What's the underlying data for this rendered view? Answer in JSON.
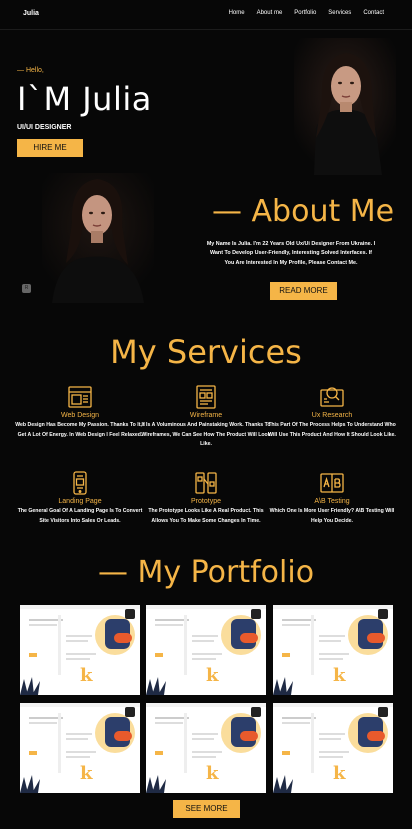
{
  "nav": {
    "logo": "Julia",
    "links": [
      "Home",
      "About me",
      "Portfolio",
      "Services",
      "Contact"
    ]
  },
  "hero": {
    "greeting": "— Hello,",
    "title": "I`M Julia",
    "role": "UI/UI DESIGNER",
    "hire_button": "HIRE ME"
  },
  "about": {
    "title": "— About Me",
    "text": "My Name Is Julia. I'm 22 Years Old Ux/Ui Designer From Ukraine. I Want To Develop User-Friendly, Interesting Solved Interfaces. If You Are Interested In My Profile, Please Contact Me.",
    "read_more": "READ MORE",
    "badge": "R"
  },
  "services": {
    "title": "My Services",
    "items": [
      {
        "icon": "web-design-icon",
        "title": "Web Design",
        "desc": "Web Design Has Become My Passion. Thanks To It, I Get A Lot Of Energy. In Web Design I Feel Relaxed."
      },
      {
        "icon": "wireframe-icon",
        "title": "Wireframe",
        "desc": "It Is A Voluminous And Painstaking Work. Thanks To Wireframes, We Can See How The Product Will Look Like."
      },
      {
        "icon": "ux-research-icon",
        "title": "Ux Research",
        "desc": "This Part Of The Process Helps To Understand Who Will Use This Product And How It Should Look Like."
      },
      {
        "icon": "landing-page-icon",
        "title": "Landing Page",
        "desc": "The General Goal Of A Landing Page Is To Convert Site Visitors Into Sales Or Leads."
      },
      {
        "icon": "prototype-icon",
        "title": "Prototype",
        "desc": "The Prototype Looks Like A Real Product. This Allows You To Make Some Changes In Time."
      },
      {
        "icon": "ab-testing-icon",
        "title": "A\\B Testing",
        "desc": "Which One Is More User Friendly? A\\B Testing Will Help You Decide."
      }
    ]
  },
  "portfolio": {
    "title": "— My Portfolio",
    "see_more": "SEE MORE",
    "thumb_letter": "k"
  },
  "colors": {
    "accent": "#f5b547",
    "background": "#070707"
  }
}
